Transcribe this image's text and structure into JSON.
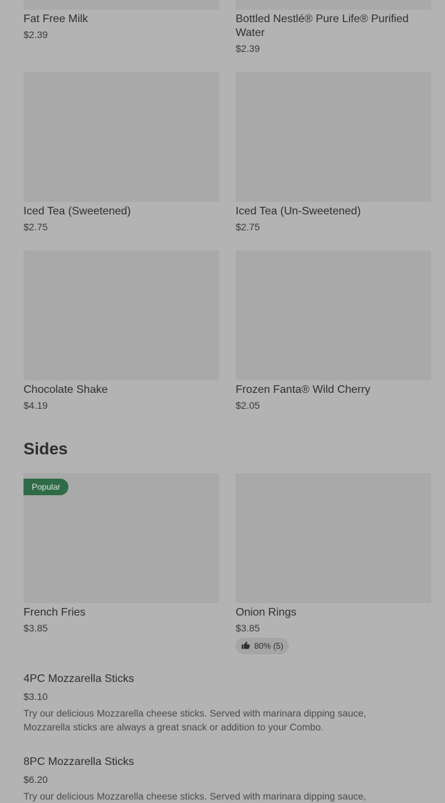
{
  "drinks": [
    {
      "title": "Fat Free Milk",
      "price": "$2.39"
    },
    {
      "title": "Bottled Nestlé® Pure Life® Purified Water",
      "price": "$2.39"
    },
    {
      "title": "Iced Tea (Sweetened)",
      "price": "$2.75"
    },
    {
      "title": "Iced Tea (Un-Sweetened)",
      "price": "$2.75"
    },
    {
      "title": "Chocolate Shake",
      "price": "$4.19"
    },
    {
      "title": "Frozen Fanta® Wild Cherry",
      "price": "$2.05"
    }
  ],
  "sides": {
    "title": "Sides",
    "cards": [
      {
        "title": "French Fries",
        "price": "$3.85",
        "badge": "Popular"
      },
      {
        "title": "Onion Rings",
        "price": "$3.85",
        "rating": "80% (5)"
      }
    ],
    "list": [
      {
        "title": "4PC Mozzarella Sticks",
        "price": "$3.10",
        "desc": "Try our delicious Mozzarella cheese sticks. Served with marinara dipping sauce, Mozzarella sticks are always a great snack or addition to your Combo."
      },
      {
        "title": "8PC Mozzarella Sticks",
        "price": "$6.20",
        "desc": "Try our delicious Mozzarella cheese sticks. Served with marinara dipping sauce,"
      }
    ]
  },
  "colors": {
    "background": "#b3b3b3",
    "image_placeholder": "#a9a9a9",
    "badge": "#2f6b47"
  },
  "icons": {
    "rating": "thumbs-up-icon"
  }
}
